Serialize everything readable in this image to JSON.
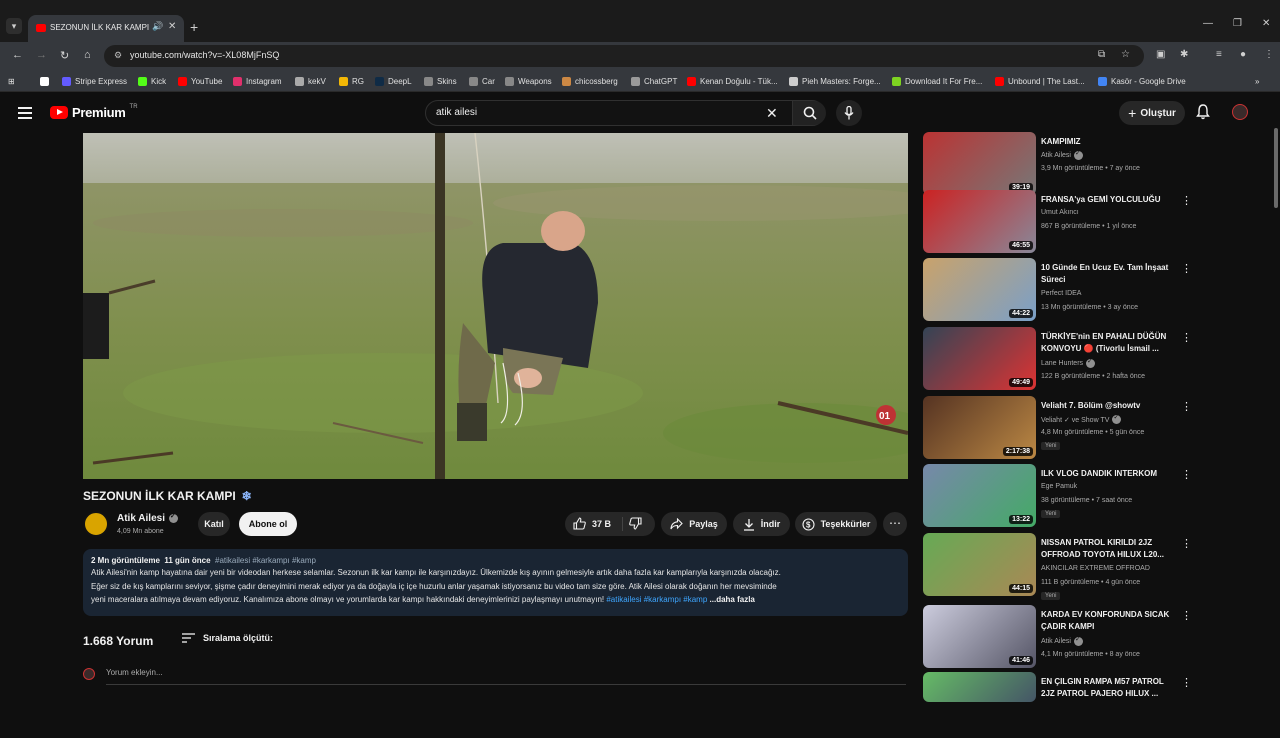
{
  "browser": {
    "tab_title": "SEZONUN İLK KAR KAMPI",
    "url": "youtube.com/watch?v=-XL08MjFnSQ",
    "bookmarks": [
      {
        "label": "",
        "color": "#ffffff"
      },
      {
        "label": "Stripe Express",
        "color": "#635bff"
      },
      {
        "label": "Kick",
        "color": "#53fc18"
      },
      {
        "label": "YouTube",
        "color": "#ff0000"
      },
      {
        "label": "Instagram",
        "color": "#e1306c"
      },
      {
        "label": "kekV",
        "color": "#aaaaaa"
      },
      {
        "label": "RG",
        "color": "#f2b705"
      },
      {
        "label": "DeepL",
        "color": "#0f2b46"
      },
      {
        "label": "Skins",
        "color": "#888888"
      },
      {
        "label": "Car",
        "color": "#888888"
      },
      {
        "label": "Weapons",
        "color": "#888888"
      },
      {
        "label": "chicossberg",
        "color": "#cc8844"
      },
      {
        "label": "ChatGPT",
        "color": "#9a9a9a"
      },
      {
        "label": "Kenan Doğulu - Tük...",
        "color": "#ff0000"
      },
      {
        "label": "Pieh Masters: Forge...",
        "color": "#cccccc"
      },
      {
        "label": "Download It For Fre...",
        "color": "#7ed321"
      },
      {
        "label": "Unbound | The Last...",
        "color": "#ff0000"
      },
      {
        "label": "Kasör - Google Drive",
        "color": "#4285f4"
      }
    ]
  },
  "header": {
    "logo_text": "Premium",
    "logo_sup": "TR",
    "search_value": "atik ailesi",
    "create_label": "Oluştur"
  },
  "video": {
    "title": "SEZONUN İLK KAR KAMPI",
    "channel": "Atik Ailesi",
    "subscribers": "4,09 Mn abone",
    "join_label": "Katıl",
    "subscribe_label": "Abone ol",
    "likes": "37 B",
    "share_label": "Paylaş",
    "download_label": "İndir",
    "thanks_label": "Teşekkürler"
  },
  "description": {
    "views": "2 Mn görüntüleme",
    "date": "11 gün önce",
    "tags": "#atikailesi #karkampı #kamp",
    "line1": "Atik Ailesi'nin kamp hayatına dair yeni bir videodan herkese selamlar. Sezonun ilk kar kampı ile karşınızdayız. Ülkemizde kış ayının gelmesiyle artık daha fazla kar kamplarıyla karşınızda olacağız.",
    "line2": "Eğer siz de kış kamplarını seviyor, şişme çadır deneyimini merak ediyor ya da doğayla iç içe huzurlu anlar yaşamak istiyorsanız bu video tam size göre. Atik Ailesi olarak doğanın her mevsiminde",
    "line3": "yeni maceralara atılmaya devam ediyoruz. Kanalımıza abone olmayı ve yorumlarda kar kampı hakkındaki deneyimlerinizi paylaşmayı unutmayın!",
    "line3_tags": "#atikailesi #karkampı #kamp",
    "more_label": "...daha fazla"
  },
  "comments": {
    "count": "1.668 Yorum",
    "sort_label": "Sıralama ölçütü:",
    "placeholder": "Yorum ekleyin..."
  },
  "recommendations": [
    {
      "title": "KAMPIMIZ",
      "channel": "Atik Ailesi",
      "verified": true,
      "stats": "3,9 Mn görüntüleme • 7 ay önce",
      "duration": "39:19",
      "badge": "",
      "colors": [
        "#b33",
        "#777"
      ]
    },
    {
      "title": "FRANSA'ya GEMİ YOLCULUĞU",
      "channel": "Umut Akıncı",
      "verified": false,
      "stats": "867 B görüntüleme • 1 yıl önce",
      "duration": "46:55",
      "badge": "",
      "colors": [
        "#c22",
        "#889"
      ]
    },
    {
      "title": "10 Günde En Ucuz Ev. Tam İnşaat Süreci",
      "channel": "Perfect IDEA",
      "verified": false,
      "stats": "13 Mn görüntüleme • 3 ay önce",
      "duration": "44:22",
      "badge": "",
      "colors": [
        "#c9a26b",
        "#7aa0c8"
      ]
    },
    {
      "title": "TÜRKİYE'nin EN PAHALI DÜĞÜN KONVOYU 🔴 (Tivorlu İsmail ...",
      "channel": "Lane Hunters",
      "verified": true,
      "stats": "122 B görüntüleme • 2 hafta önce",
      "duration": "49:49",
      "badge": "",
      "colors": [
        "#345",
        "#d33"
      ]
    },
    {
      "title": "Veliaht 7. Bölüm @showtv",
      "channel": "Veliaht ✓ ve Show TV",
      "verified": true,
      "stats": "4,8 Mn görüntüleme • 5 gün önce",
      "duration": "2:17:38",
      "badge": "Yeni",
      "colors": [
        "#532",
        "#b84"
      ]
    },
    {
      "title": "ILK VLOG DANDIK INTERKOM",
      "channel": "Ege Pamuk",
      "verified": false,
      "stats": "38 görüntüleme • 7 saat önce",
      "duration": "13:22",
      "badge": "Yeni",
      "colors": [
        "#78a",
        "#4a6"
      ]
    },
    {
      "title": "NISSAN PATROL KIRILDI 2JZ OFFROAD TOYOTA HILUX L20...",
      "channel": "AKINCILAR EXTREME OFFROAD",
      "verified": false,
      "stats": "111 B görüntüleme • 4 gün önce",
      "duration": "44:15",
      "badge": "Yeni",
      "colors": [
        "#6a5",
        "#a85"
      ]
    },
    {
      "title": "KARDA EV KONFORUNDA SICAK ÇADIR KAMPI",
      "channel": "Atik Ailesi",
      "verified": true,
      "stats": "4,1 Mn görüntüleme • 8 ay önce",
      "duration": "41:46",
      "badge": "",
      "colors": [
        "#ccd",
        "#556"
      ]
    },
    {
      "title": "EN ÇILGIN RAMPA M57 PATROL 2JZ PATROL PAJERO HILUX ...",
      "channel": "",
      "verified": false,
      "stats": "",
      "duration": "",
      "badge": "",
      "colors": [
        "#6b6",
        "#456"
      ]
    }
  ]
}
